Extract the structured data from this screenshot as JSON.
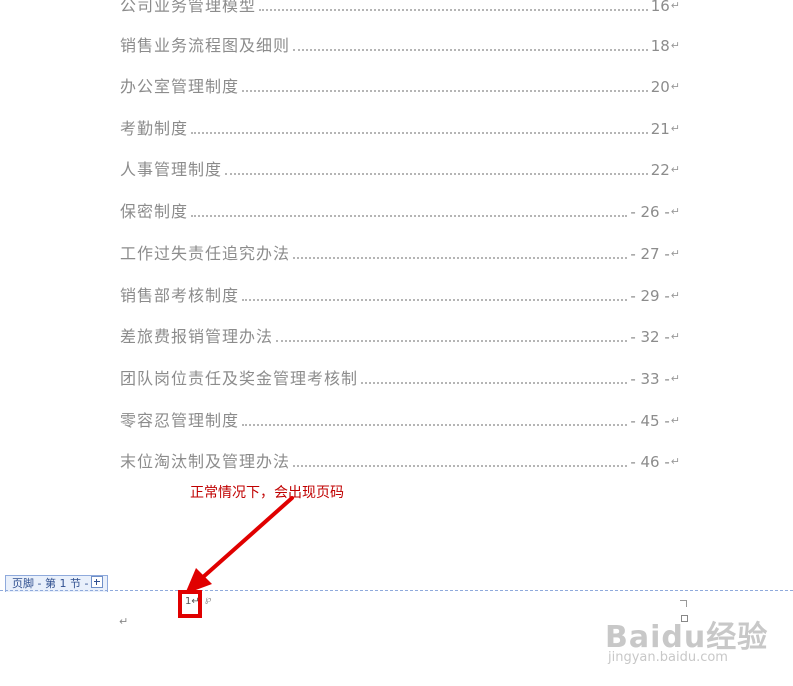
{
  "toc": {
    "items": [
      {
        "title": "公司业务管理模型",
        "page": "16"
      },
      {
        "title": "销售业务流程图及细则",
        "page": "18"
      },
      {
        "title": "办公室管理制度",
        "page": "20"
      },
      {
        "title": "考勤制度",
        "page": "21"
      },
      {
        "title": "人事管理制度",
        "page": "22"
      },
      {
        "title": "保密制度",
        "page": "- 26 -"
      },
      {
        "title": "工作过失责任追究办法",
        "page": "- 27 -"
      },
      {
        "title": "销售部考核制度",
        "page": "- 29 -"
      },
      {
        "title": "差旅费报销管理办法",
        "page": "- 32 -"
      },
      {
        "title": "团队岗位责任及奖金管理考核制",
        "page": "- 33 -"
      },
      {
        "title": "零容忍管理制度",
        "page": "- 45 -"
      },
      {
        "title": "末位淘汰制及管理办法",
        "page": "- 46 -"
      }
    ],
    "return_mark": "↵"
  },
  "annotation": {
    "text": "正常情况下，会出现页码",
    "color": "#c00000"
  },
  "footer": {
    "tag_label": "页脚 - 第 1 节 -",
    "page_number": "1",
    "return_mark": "↵",
    "line_color": "#8faadc"
  },
  "watermark": {
    "brand": "Baidu经验",
    "url": "jingyan.baidu.com"
  }
}
